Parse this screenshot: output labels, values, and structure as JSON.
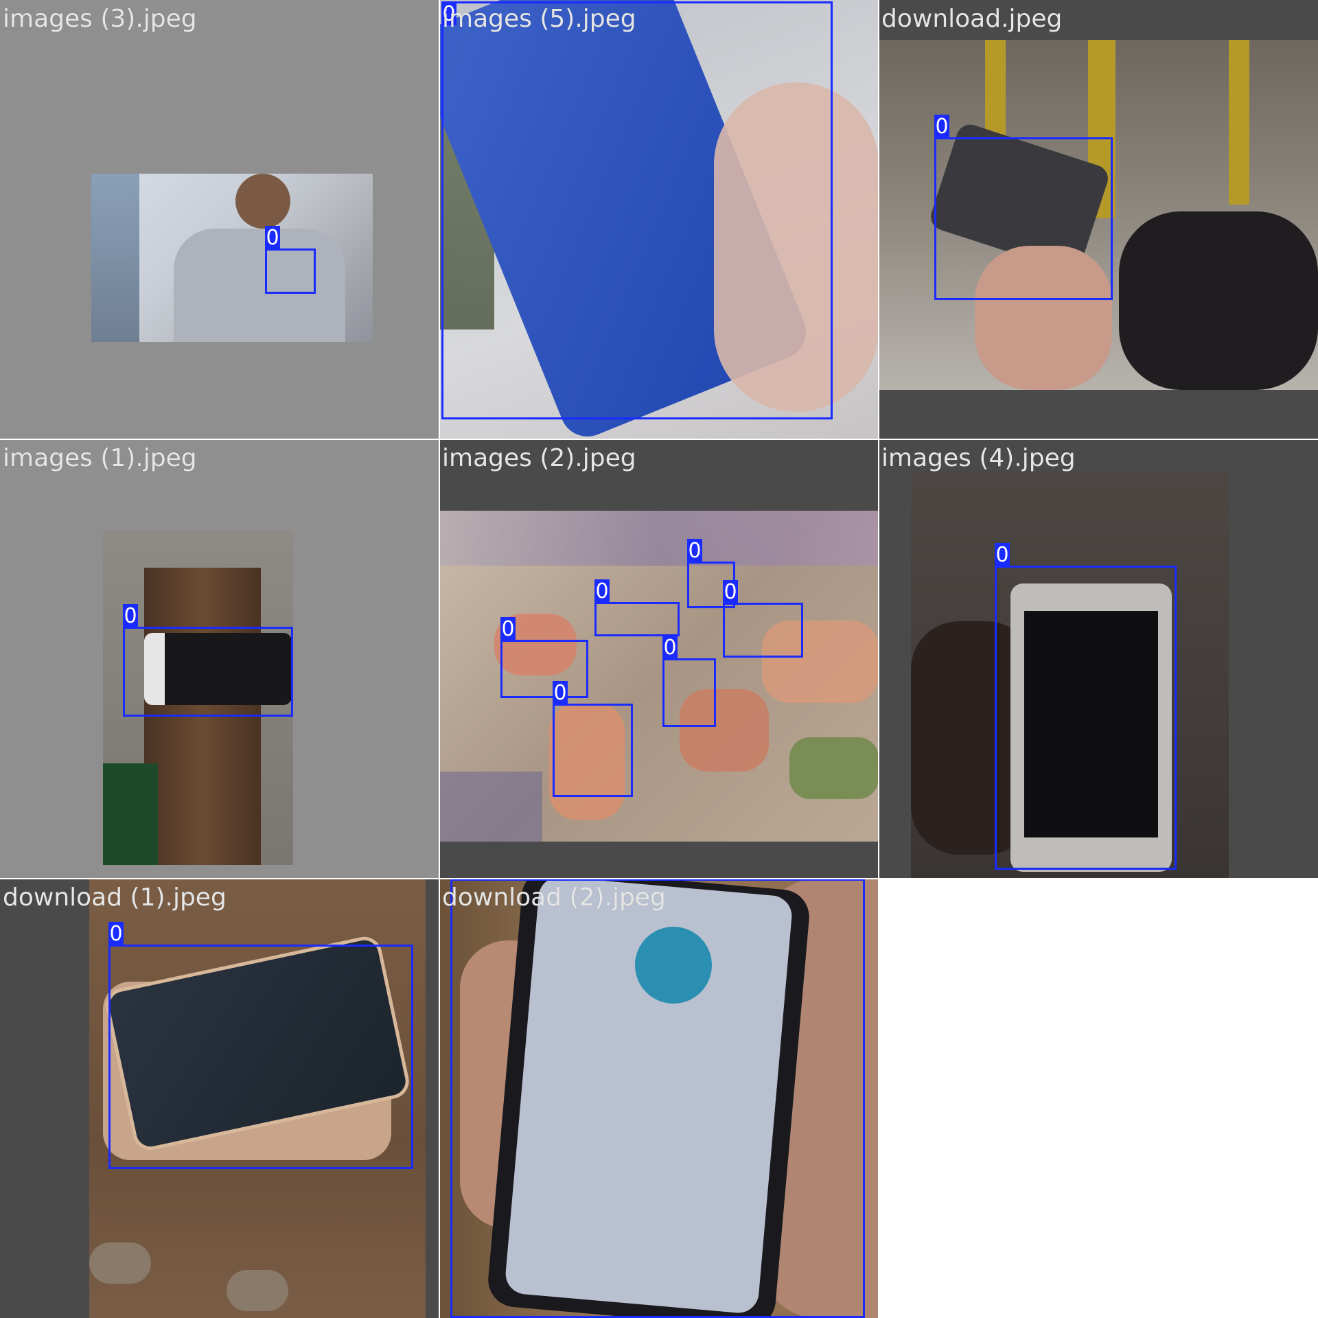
{
  "tiles": [
    {
      "filename": "images (3).jpeg",
      "detections": [
        "0"
      ]
    },
    {
      "filename": "images (5).jpeg",
      "detections": [
        "0"
      ]
    },
    {
      "filename": "download.jpeg",
      "detections": [
        "0"
      ]
    },
    {
      "filename": "images (1).jpeg",
      "detections": [
        "0"
      ]
    },
    {
      "filename": "images (2).jpeg",
      "detections": [
        "0",
        "0",
        "0",
        "0",
        "0",
        "0"
      ]
    },
    {
      "filename": "images (4).jpeg",
      "detections": [
        "0"
      ]
    },
    {
      "filename": "download (1).jpeg",
      "detections": [
        "0"
      ]
    },
    {
      "filename": "download (2).jpeg",
      "detections": [
        "0"
      ]
    }
  ],
  "colors": {
    "box": "#1a2bff",
    "label_text": "#e6e6e6",
    "grey_pad": "#8f8f8f",
    "dark_pad": "#4a4a4a"
  }
}
